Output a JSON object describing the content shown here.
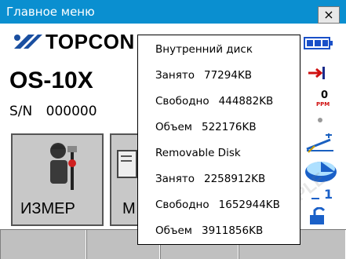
{
  "window": {
    "title": "Главное меню",
    "close_label": "×"
  },
  "brand": {
    "name": "TOPCON"
  },
  "device": {
    "model": "OS-10X",
    "serial_label": "S/N",
    "serial_value": "000000"
  },
  "tiles": [
    {
      "label": "ИЗМЕР"
    },
    {
      "label": "М"
    }
  ],
  "popup": {
    "internal": {
      "title": "Внутренний диск",
      "used_label": "Занято",
      "used_value": "77294KB",
      "free_label": "Свободно",
      "free_value": "444882KB",
      "total_label": "Объем",
      "total_value": "522176KB"
    },
    "removable": {
      "title": "Removable Disk",
      "used_label": "Занято",
      "used_value": "2258912KB",
      "free_label": "Свободно",
      "free_value": "1652944KB",
      "total_label": "Объем",
      "total_value": "3911856KB"
    }
  },
  "sidebar": {
    "ppm_value": "0",
    "ppm_unit": "PPM",
    "page_number": "1",
    "icons": [
      "battery-icon",
      "target-icon",
      "ppm-icon",
      "dot-icon",
      "tilt-icon",
      "disk-icon",
      "page-icon",
      "lock-icon"
    ]
  },
  "colors": {
    "titlebar": "#0a8fd0",
    "accent_blue": "#1a6fd0",
    "accent_red": "#d01010",
    "bottombar": "#c0c0c0"
  }
}
